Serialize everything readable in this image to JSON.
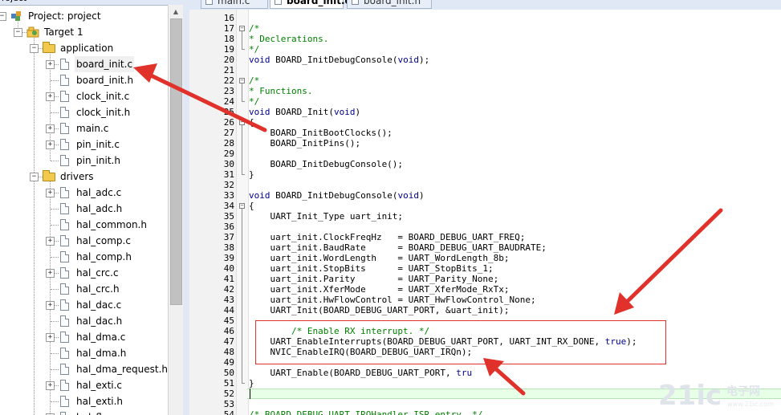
{
  "project_pane": {
    "header_title": "roject",
    "close_glyph": "×",
    "tree": [
      {
        "label": "Project: project",
        "icon": "project-icon",
        "level": 0,
        "expander": "minus"
      },
      {
        "label": "Target 1",
        "icon": "target-icon",
        "level": 1,
        "expander": "minus"
      },
      {
        "label": "application",
        "icon": "folder-icon",
        "level": 2,
        "expander": "minus"
      },
      {
        "label": "board_init.c",
        "icon": "file-icon",
        "level": 3,
        "expander": "plus",
        "selected": true
      },
      {
        "label": "board_init.h",
        "icon": "file-icon",
        "level": 3,
        "expander": null
      },
      {
        "label": "clock_init.c",
        "icon": "file-icon",
        "level": 3,
        "expander": "plus"
      },
      {
        "label": "clock_init.h",
        "icon": "file-icon",
        "level": 3,
        "expander": null
      },
      {
        "label": "main.c",
        "icon": "file-icon",
        "level": 3,
        "expander": "plus"
      },
      {
        "label": "pin_init.c",
        "icon": "file-icon",
        "level": 3,
        "expander": "plus"
      },
      {
        "label": "pin_init.h",
        "icon": "file-icon",
        "level": 3,
        "expander": null
      },
      {
        "label": "drivers",
        "icon": "folder-icon",
        "level": 2,
        "expander": "minus"
      },
      {
        "label": "hal_adc.c",
        "icon": "file-icon",
        "level": 3,
        "expander": "plus"
      },
      {
        "label": "hal_adc.h",
        "icon": "file-icon",
        "level": 3,
        "expander": null
      },
      {
        "label": "hal_common.h",
        "icon": "file-icon",
        "level": 3,
        "expander": null
      },
      {
        "label": "hal_comp.c",
        "icon": "file-icon",
        "level": 3,
        "expander": "plus"
      },
      {
        "label": "hal_comp.h",
        "icon": "file-icon",
        "level": 3,
        "expander": null
      },
      {
        "label": "hal_crc.c",
        "icon": "file-icon",
        "level": 3,
        "expander": "plus"
      },
      {
        "label": "hal_crc.h",
        "icon": "file-icon",
        "level": 3,
        "expander": null
      },
      {
        "label": "hal_dac.c",
        "icon": "file-icon",
        "level": 3,
        "expander": "plus"
      },
      {
        "label": "hal_dac.h",
        "icon": "file-icon",
        "level": 3,
        "expander": null
      },
      {
        "label": "hal_dma.c",
        "icon": "file-icon",
        "level": 3,
        "expander": "plus"
      },
      {
        "label": "hal_dma.h",
        "icon": "file-icon",
        "level": 3,
        "expander": null
      },
      {
        "label": "hal_dma_request.h",
        "icon": "file-icon",
        "level": 3,
        "expander": null
      },
      {
        "label": "hal_exti.c",
        "icon": "file-icon",
        "level": 3,
        "expander": "plus"
      },
      {
        "label": "hal_exti.h",
        "icon": "file-icon",
        "level": 3,
        "expander": null
      },
      {
        "label": "hal_fla...",
        "icon": "file-icon",
        "level": 3,
        "expander": "plus"
      }
    ]
  },
  "tabs": [
    {
      "label": "main.c",
      "active": false
    },
    {
      "label": "board_init.c",
      "active": true
    },
    {
      "label": "board_init.h",
      "active": false
    }
  ],
  "editor": {
    "lines": [
      {
        "n": "16",
        "segs": []
      },
      {
        "n": "17",
        "fold": "open",
        "segs": [
          {
            "t": "c",
            "v": "/*"
          }
        ]
      },
      {
        "n": "18",
        "segs": [
          {
            "t": "c",
            "v": "* Declerations."
          }
        ]
      },
      {
        "n": "19",
        "fold": "end",
        "segs": [
          {
            "t": "c",
            "v": "*/"
          }
        ]
      },
      {
        "n": "20",
        "segs": [
          {
            "t": "k",
            "v": "void"
          },
          {
            "t": "p",
            "v": " BOARD_InitDebugConsole("
          },
          {
            "t": "k",
            "v": "void"
          },
          {
            "t": "p",
            "v": ");"
          }
        ]
      },
      {
        "n": "21",
        "segs": []
      },
      {
        "n": "22",
        "fold": "open",
        "segs": [
          {
            "t": "c",
            "v": "/*"
          }
        ]
      },
      {
        "n": "23",
        "segs": [
          {
            "t": "c",
            "v": "* Functions."
          }
        ]
      },
      {
        "n": "24",
        "fold": "end",
        "segs": [
          {
            "t": "c",
            "v": "*/"
          }
        ]
      },
      {
        "n": "25",
        "segs": [
          {
            "t": "k",
            "v": "void"
          },
          {
            "t": "p",
            "v": " BOARD_Init("
          },
          {
            "t": "k",
            "v": "void"
          },
          {
            "t": "p",
            "v": ")"
          }
        ]
      },
      {
        "n": "26",
        "fold": "open",
        "segs": [
          {
            "t": "p",
            "v": "{"
          }
        ]
      },
      {
        "n": "27",
        "segs": [
          {
            "t": "p",
            "v": "    BOARD_InitBootClocks();"
          }
        ]
      },
      {
        "n": "28",
        "segs": [
          {
            "t": "p",
            "v": "    BOARD_InitPins();"
          }
        ]
      },
      {
        "n": "29",
        "segs": []
      },
      {
        "n": "30",
        "segs": [
          {
            "t": "p",
            "v": "    BOARD_InitDebugConsole();"
          }
        ]
      },
      {
        "n": "31",
        "fold": "end",
        "segs": [
          {
            "t": "p",
            "v": "}"
          }
        ]
      },
      {
        "n": "32",
        "segs": []
      },
      {
        "n": "33",
        "segs": [
          {
            "t": "k",
            "v": "void"
          },
          {
            "t": "p",
            "v": " BOARD_InitDebugConsole("
          },
          {
            "t": "k",
            "v": "void"
          },
          {
            "t": "p",
            "v": ")"
          }
        ]
      },
      {
        "n": "34",
        "fold": "open",
        "segs": [
          {
            "t": "p",
            "v": "{"
          }
        ]
      },
      {
        "n": "35",
        "segs": [
          {
            "t": "p",
            "v": "    UART_Init_Type uart_init;"
          }
        ]
      },
      {
        "n": "36",
        "segs": []
      },
      {
        "n": "37",
        "segs": [
          {
            "t": "p",
            "v": "    uart_init.ClockFreqHz   = BOARD_DEBUG_UART_FREQ;"
          }
        ]
      },
      {
        "n": "38",
        "segs": [
          {
            "t": "p",
            "v": "    uart_init.BaudRate      = BOARD_DEBUG_UART_BAUDRATE;"
          }
        ]
      },
      {
        "n": "39",
        "segs": [
          {
            "t": "p",
            "v": "    uart_init.WordLength    = UART_WordLength_8b;"
          }
        ]
      },
      {
        "n": "40",
        "segs": [
          {
            "t": "p",
            "v": "    uart_init.StopBits      = UART_StopBits_1;"
          }
        ]
      },
      {
        "n": "41",
        "segs": [
          {
            "t": "p",
            "v": "    uart_init.Parity        = UART_Parity_None;"
          }
        ]
      },
      {
        "n": "42",
        "segs": [
          {
            "t": "p",
            "v": "    uart_init.XferMode      = UART_XferMode_RxTx;"
          }
        ]
      },
      {
        "n": "43",
        "segs": [
          {
            "t": "p",
            "v": "    uart_init.HwFlowControl = UART_HwFlowControl_None;"
          }
        ]
      },
      {
        "n": "44",
        "segs": [
          {
            "t": "p",
            "v": "    UART_Init(BOARD_DEBUG_UART_PORT, &uart_init);"
          }
        ]
      },
      {
        "n": "45",
        "segs": []
      },
      {
        "n": "46",
        "segs": [
          {
            "t": "c",
            "v": "        /* Enable RX interrupt. */"
          }
        ]
      },
      {
        "n": "47",
        "segs": [
          {
            "t": "p",
            "v": "    UART_EnableInterrupts(BOARD_DEBUG_UART_PORT, UART_INT_RX_DONE, "
          },
          {
            "t": "k",
            "v": "true"
          },
          {
            "t": "p",
            "v": ");"
          }
        ]
      },
      {
        "n": "48",
        "segs": [
          {
            "t": "p",
            "v": "    NVIC_EnableIRQ(BOARD_DEBUG_UART_IRQn);"
          }
        ]
      },
      {
        "n": "49",
        "segs": []
      },
      {
        "n": "50",
        "segs": [
          {
            "t": "p",
            "v": "    UART_Enable(BOARD_DEBUG_UART_PORT, "
          },
          {
            "t": "k",
            "v": "tru"
          }
        ]
      },
      {
        "n": "51",
        "fold": "end",
        "segs": [
          {
            "t": "p",
            "v": "}"
          }
        ]
      },
      {
        "n": "52",
        "segs": []
      },
      {
        "n": "53",
        "segs": []
      },
      {
        "n": "54",
        "segs": [
          {
            "t": "c",
            "v": "/* BOARD_DEBUG_UART_IRQHandler_ISR entry. */"
          }
        ]
      }
    ]
  },
  "watermark": {
    "text": "21ic",
    "cn": "电子网",
    "url": "www.21ic.com"
  },
  "colors": {
    "annotation_red": "#e0312b",
    "comment_green": "#008000",
    "keyword_blue": "#00008b",
    "current_line": "#e6ffe6"
  }
}
